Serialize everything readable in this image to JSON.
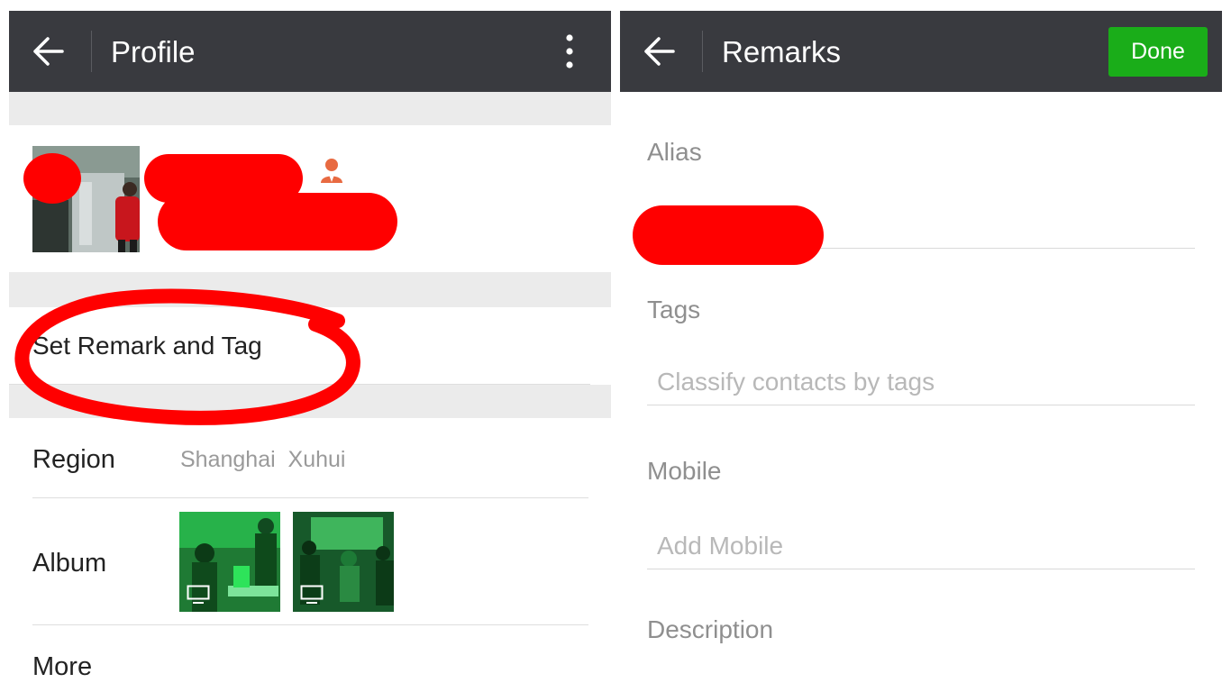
{
  "profile_screen": {
    "title": "Profile",
    "icons": {
      "back": "arrow-left-icon",
      "menu": "more-vertical-icon",
      "contact": "person-icon",
      "album_badge": "tv-icon"
    },
    "set_remark_label": "Set Remark and Tag",
    "rows": {
      "region": {
        "label": "Region",
        "value": "Shanghai  Xuhui"
      },
      "album": {
        "label": "Album"
      },
      "more": {
        "label": "More"
      }
    }
  },
  "remarks_screen": {
    "title": "Remarks",
    "done_label": "Done",
    "fields": {
      "alias": {
        "label": "Alias",
        "value": ""
      },
      "tags": {
        "label": "Tags",
        "placeholder": "Classify contacts by tags"
      },
      "mobile": {
        "label": "Mobile",
        "placeholder": "Add Mobile"
      },
      "description": {
        "label": "Description"
      }
    }
  },
  "colors": {
    "topbar": "#393a3f",
    "done_button": "#1aad19",
    "redaction": "#ff0000",
    "section_gap": "#ebebeb",
    "secondary_text": "#9a9a9a",
    "album_tint": "#1eb44a"
  }
}
